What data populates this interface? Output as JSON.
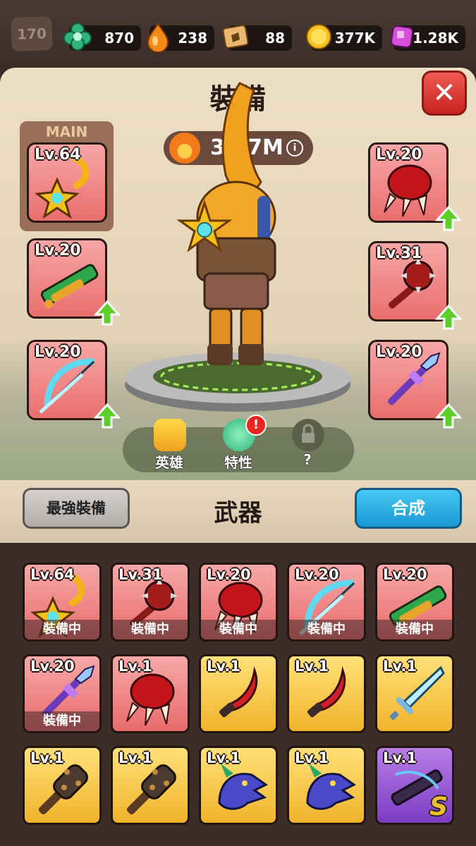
{
  "topbar": {
    "player_level": "170",
    "resources": [
      {
        "name": "clover-gem",
        "value": "870",
        "color": "#2fb37a"
      },
      {
        "name": "fire-drop",
        "value": "238",
        "color": "#f28a1a"
      },
      {
        "name": "scroll",
        "value": "88",
        "color": "#d8a25a"
      },
      {
        "name": "gold-coin",
        "value": "377K",
        "color": "#f5c21e"
      },
      {
        "name": "purple-gem",
        "value": "1.28K",
        "color": "#d64fd8"
      }
    ]
  },
  "panel": {
    "title": "裝備",
    "power": "33.7M",
    "info_glyph": "i",
    "close_glyph": "✕",
    "main_label": "MAIN",
    "slots": [
      {
        "level": "Lv.64",
        "icon": "golden-sun-staff-icon",
        "upgrade": false
      },
      {
        "level": "Lv.20",
        "icon": "green-crossbow-icon",
        "upgrade": true
      },
      {
        "level": "Lv.20",
        "icon": "ice-bow-icon",
        "upgrade": true
      },
      {
        "level": "Lv.20",
        "icon": "red-claw-icon",
        "upgrade": true
      },
      {
        "level": "Lv.31",
        "icon": "spiked-mace-icon",
        "upgrade": true
      },
      {
        "level": "Lv.20",
        "icon": "purple-spear-icon",
        "upgrade": true
      }
    ],
    "tabs": [
      {
        "label": "英雄",
        "icon": "hero-icon"
      },
      {
        "label": "特性",
        "icon": "trait-icon"
      },
      {
        "label": "?",
        "icon": "lock-icon"
      }
    ],
    "trait_badge": "!"
  },
  "inventory": {
    "best_button": "最強裝備",
    "title": "武器",
    "synth_button": "合成",
    "equipped_label": "裝備中",
    "items": [
      {
        "level": "Lv.64",
        "rarity": "red",
        "icon": "golden-sun-staff-icon",
        "equipped": true
      },
      {
        "level": "Lv.31",
        "rarity": "red",
        "icon": "spiked-mace-icon",
        "equipped": true
      },
      {
        "level": "Lv.20",
        "rarity": "red",
        "icon": "red-claw-icon",
        "equipped": true
      },
      {
        "level": "Lv.20",
        "rarity": "red",
        "icon": "ice-bow-icon",
        "equipped": true
      },
      {
        "level": "Lv.20",
        "rarity": "red",
        "icon": "green-crossbow-icon",
        "equipped": true
      },
      {
        "level": "Lv.20",
        "rarity": "red",
        "icon": "purple-spear-icon",
        "equipped": true
      },
      {
        "level": "Lv.1",
        "rarity": "red",
        "icon": "red-claw-icon",
        "equipped": false
      },
      {
        "level": "Lv.1",
        "rarity": "gold",
        "icon": "red-dagger-icon",
        "equipped": false
      },
      {
        "level": "Lv.1",
        "rarity": "gold",
        "icon": "red-dagger-icon",
        "equipped": false
      },
      {
        "level": "Lv.1",
        "rarity": "gold",
        "icon": "ice-sword-icon",
        "equipped": false
      },
      {
        "level": "Lv.1",
        "rarity": "gold",
        "icon": "wooden-mace-icon",
        "equipped": false
      },
      {
        "level": "Lv.1",
        "rarity": "gold",
        "icon": "wooden-mace-icon",
        "equipped": false
      },
      {
        "level": "Lv.1",
        "rarity": "gold",
        "icon": "dragon-head-icon",
        "equipped": false
      },
      {
        "level": "Lv.1",
        "rarity": "gold",
        "icon": "dragon-head-icon",
        "equipped": false
      },
      {
        "level": "Lv.1",
        "rarity": "purple",
        "icon": "purple-crossbow-icon",
        "equipped": false,
        "grade": "S"
      }
    ]
  }
}
